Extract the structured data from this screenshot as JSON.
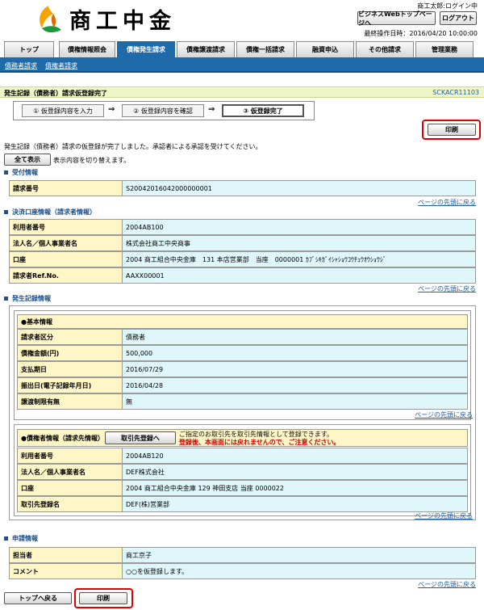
{
  "header": {
    "logo_text": "商工中金",
    "user_status": "商工太郎:ログイン中",
    "biz_top_button": "ビジネスWebトップページへ",
    "logout_button": "ログアウト",
    "last_login": "最終操作日時：2016/04/20 10:00:00"
  },
  "tabs": [
    "トップ",
    "債権情報照会",
    "債権発生請求",
    "債権譲渡請求",
    "債権一括請求",
    "融資申込",
    "その他請求",
    "管理業務"
  ],
  "subnav": [
    "債務者請求",
    "債権者請求"
  ],
  "page": {
    "title": "発生記録（債務者）請求仮登録完了",
    "code": "SCKACR11103"
  },
  "steps": {
    "s1": "① 仮登録内容を入力",
    "s2": "② 仮登録内容を確認",
    "s3": "③ 仮登録完了",
    "arrow": "⇒"
  },
  "print_button": "印刷",
  "message": "発生記録（債務者）請求の仮登録が完了しました。承認者による承認を受けてください。",
  "show_all_button": "全て表示",
  "toggle_text": "表示内容を切り替えます。",
  "to_top_link": "ページの先頭に戻る",
  "receipt": {
    "title": "受付情報",
    "rows": [
      {
        "label": "請求番号",
        "value": "S20042016042000000001"
      }
    ]
  },
  "settlement": {
    "title": "決済口座情報（請求者情報）",
    "rows": [
      {
        "label": "利用者番号",
        "value": "2004AB100"
      },
      {
        "label": "法人名／個人事業者名",
        "value": "株式会社商工中央商事"
      },
      {
        "label": "口座",
        "value": "2004 商工組合中央金庫　131 本店営業部　当座　0000001 ｶﾌﾞｼｷｶﾞｲｼｬｼｮｳｺｳﾁｭｳｵｳｼｮｳｼﾞ"
      },
      {
        "label": "請求者Ref.No.",
        "value": "AAXX00001"
      }
    ]
  },
  "occurrence": {
    "title": "発生記録情報",
    "basic_title": "●基本情報",
    "basic_rows": [
      {
        "label": "請求者区分",
        "value": "債務者"
      },
      {
        "label": "債権金額(円)",
        "value": "500,000"
      },
      {
        "label": "支払期日",
        "value": "2016/07/29"
      },
      {
        "label": "振出日(電子記録年月日)",
        "value": "2016/04/28"
      },
      {
        "label": "譲渡制限有無",
        "value": "無"
      }
    ],
    "creditor_title": "●債権者情報（請求先情報）",
    "register_partner_button": "取引先登録へ",
    "register_note": "ご指定のお取引先を取引先情報として登録できます。",
    "register_warning": "登録後、本画面には戻れませんので、ご注意ください。",
    "creditor_rows": [
      {
        "label": "利用者番号",
        "value": "2004AB120"
      },
      {
        "label": "法人名／個人事業者名",
        "value": "DEF株式会社"
      },
      {
        "label": "口座",
        "value": "2004 商工組合中央金庫 129 神田支店 当座 0000022"
      },
      {
        "label": "取引先登録名",
        "value": "DEF(株)営業部"
      }
    ]
  },
  "application": {
    "title": "申請情報",
    "rows": [
      {
        "label": "担当者",
        "value": "商工京子"
      },
      {
        "label": "コメント",
        "value": "○○を仮登録します。"
      }
    ]
  },
  "back_top_button": "トップへ戻る",
  "colors": {
    "nav_blue": "#1f6aa8",
    "label_bg": "#fff6c8",
    "value_bg": "#dff7fb",
    "highlight_red": "#e00000"
  }
}
